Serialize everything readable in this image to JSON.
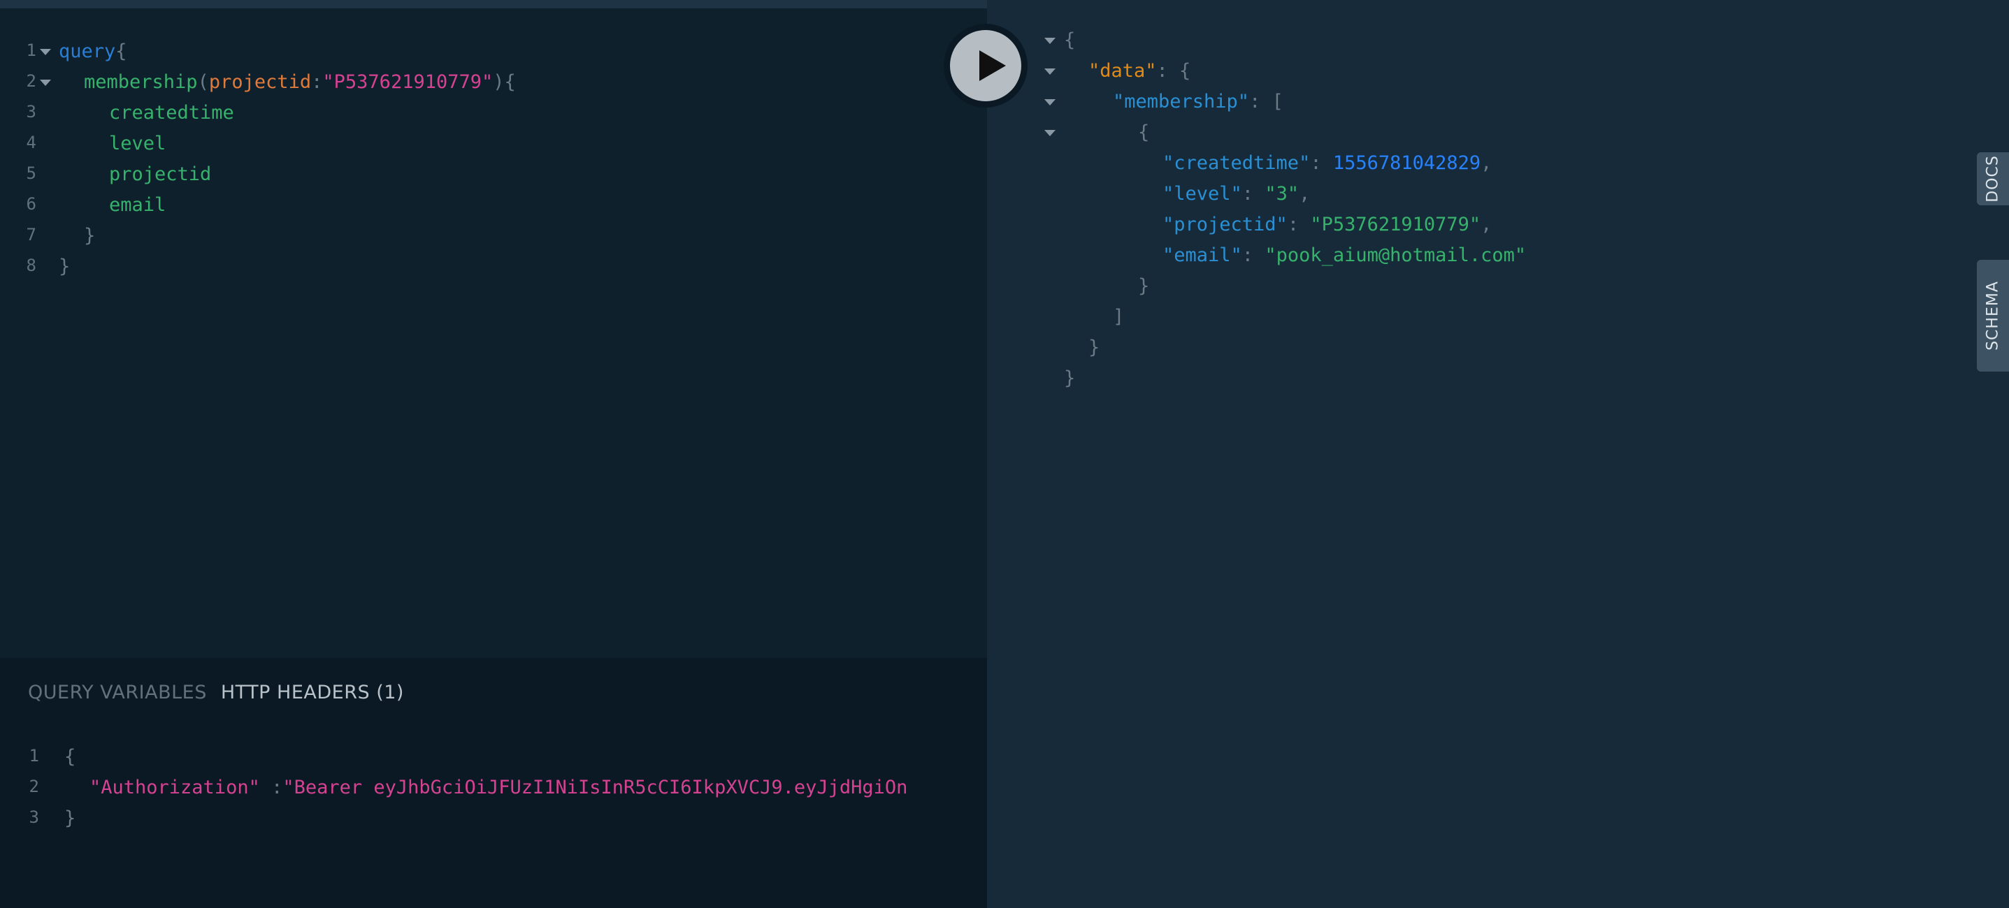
{
  "query_editor": {
    "line_numbers": [
      "1",
      "2",
      "3",
      "4",
      "5",
      "6",
      "7",
      "8"
    ],
    "query_keyword": "query",
    "open_brace": "{",
    "field_name": "membership",
    "paren_open": "(",
    "arg_name": "projectid",
    "colon": ":",
    "arg_value": "\"P537621910779\"",
    "paren_close_brace": "){",
    "fields": [
      "createdtime",
      "level",
      "projectid",
      "email"
    ],
    "inner_close": "}",
    "outer_close": "}"
  },
  "run_button": {
    "icon": "play-icon"
  },
  "bottom_panel": {
    "tab_variables": "QUERY VARIABLES",
    "tab_headers": "HTTP HEADERS (1)",
    "line_numbers": [
      "1",
      "2",
      "3"
    ],
    "open_brace": "{",
    "header_key": "\"Authorization\"",
    "header_sep": " :",
    "header_value": "\"Bearer eyJhbGciOiJFUzI1NiIsInR5cCI6IkpXVCJ9.eyJjdHgiOn",
    "close_brace": "}"
  },
  "result": {
    "open_brace": "{",
    "data_key": "\"data\"",
    "data_sep": ": {",
    "membership_key": "\"membership\"",
    "membership_sep": ": [",
    "item_open": "{",
    "createdtime_key": "\"createdtime\"",
    "createdtime_value": "1556781042829",
    "level_key": "\"level\"",
    "level_value": "\"3\"",
    "projectid_key": "\"projectid\"",
    "projectid_value": "\"P537621910779\"",
    "email_key": "\"email\"",
    "email_value": "\"pook_aium@hotmail.com\"",
    "sep": ": ",
    "comma": ",",
    "item_close": "}",
    "array_close": "]",
    "data_close": "}",
    "root_close": "}"
  },
  "side_tabs": {
    "docs": "DOCS",
    "schema": "SCHEMA"
  }
}
